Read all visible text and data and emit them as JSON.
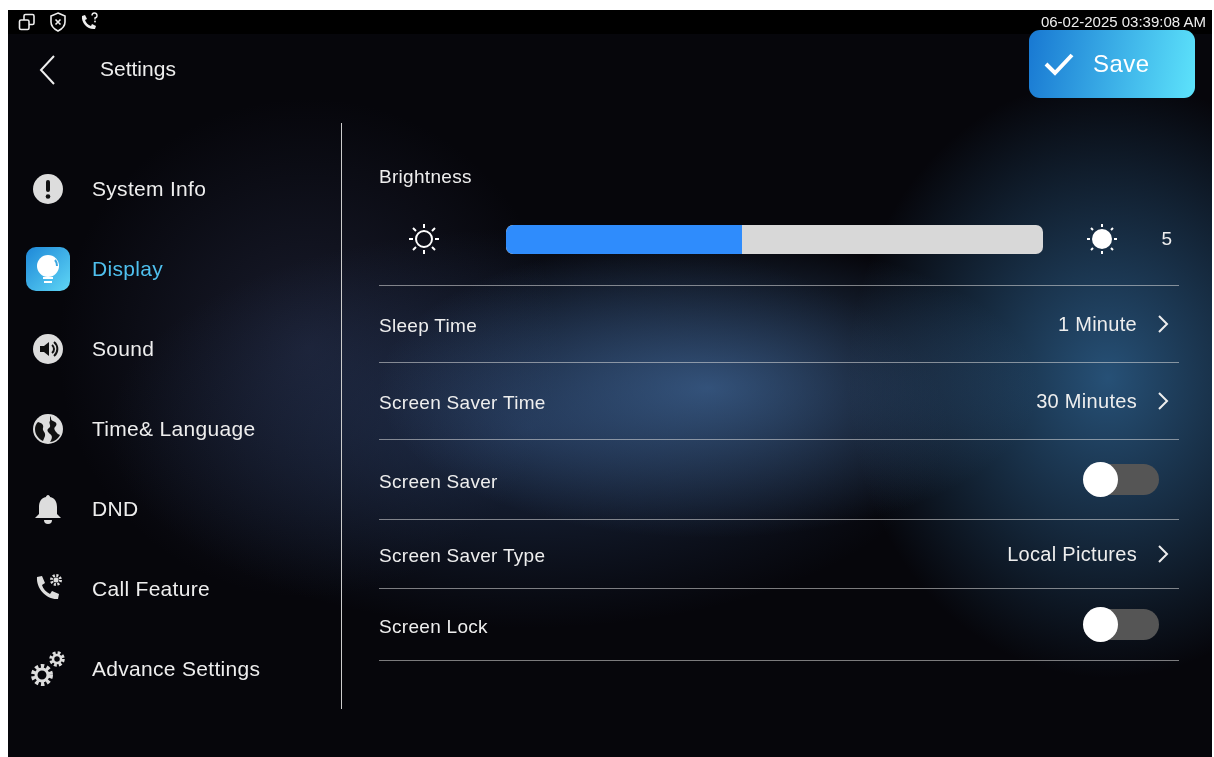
{
  "status_bar": {
    "time": "06-02-2025 03:39:08 AM"
  },
  "header": {
    "title": "Settings",
    "save_button": "Save"
  },
  "sidebar": {
    "items": [
      {
        "label": "System Info",
        "selected": false
      },
      {
        "label": "Display",
        "selected": true
      },
      {
        "label": "Sound",
        "selected": false
      },
      {
        "label": "Time& Language",
        "selected": false
      },
      {
        "label": "DND",
        "selected": false
      },
      {
        "label": "Call Feature",
        "selected": false
      },
      {
        "label": "Advance Settings",
        "selected": false
      }
    ]
  },
  "settings": [
    {
      "kind": "slider",
      "label": "Brightness",
      "level": 0.44,
      "reading": "5"
    },
    {
      "kind": "value",
      "label": "Sleep Time",
      "value": "1 Minute"
    },
    {
      "kind": "value",
      "label": "Screen Saver Time",
      "value": "30 Minutes"
    },
    {
      "kind": "toggle",
      "label": "Screen Saver",
      "on": false
    },
    {
      "kind": "value",
      "label": "Screen Saver Type",
      "value": "Local Pictures"
    },
    {
      "kind": "toggle",
      "label": "Screen Lock",
      "on": false
    }
  ]
}
